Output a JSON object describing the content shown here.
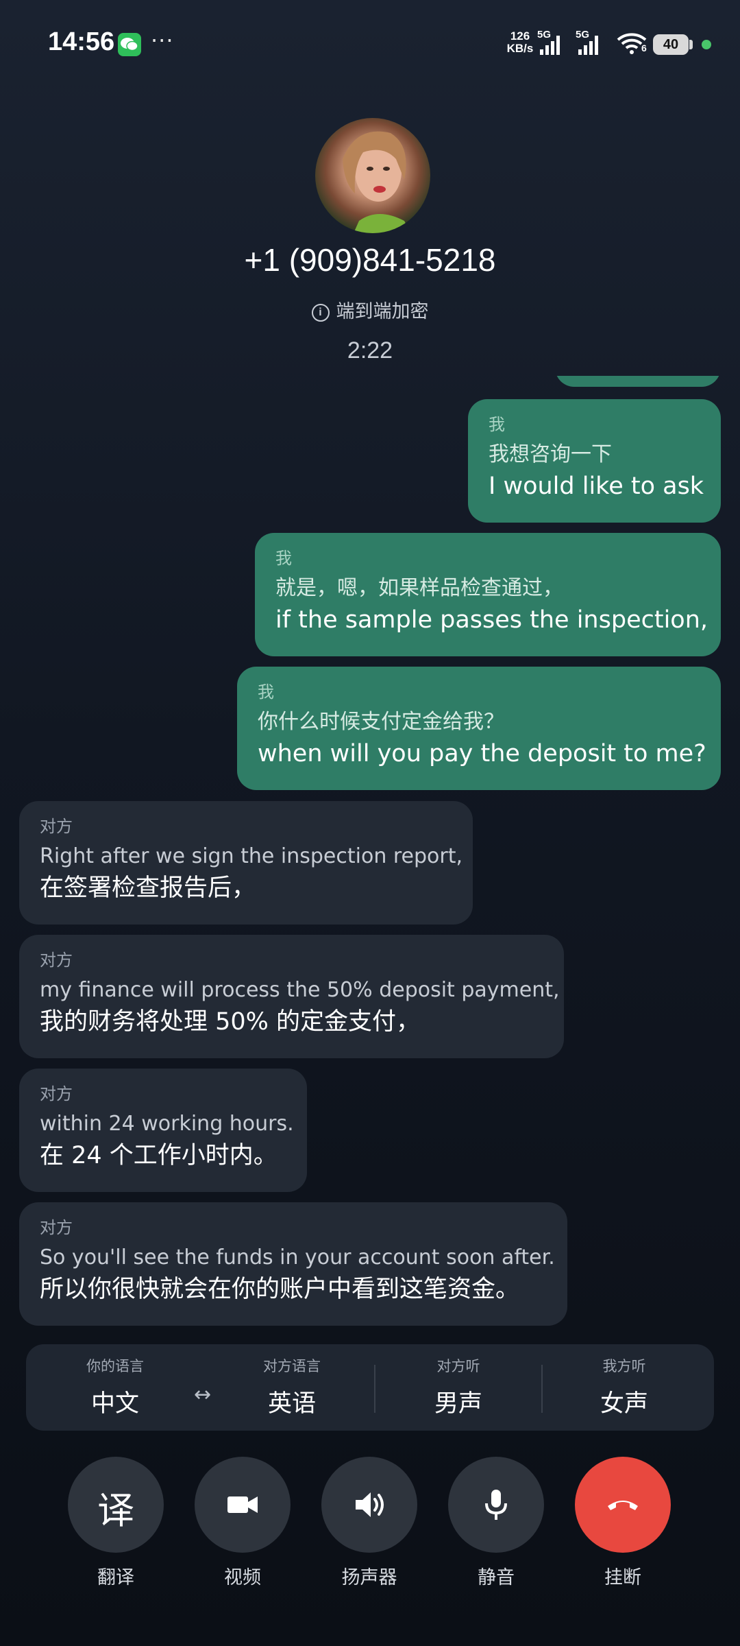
{
  "status_bar": {
    "time": "14:56",
    "more": "···",
    "net_speed_value": "126",
    "net_speed_unit": "KB/s",
    "sim1_label": "5G",
    "sim2_label": "5G",
    "wifi_label": "6",
    "battery": "40"
  },
  "call": {
    "contact_number": "+1 (909)841-5218",
    "encryption_label": "端到端加密",
    "duration": "2:22"
  },
  "transcript": [
    {
      "speaker": "我",
      "source": "我想咨询一下",
      "translation": "I would like to ask"
    },
    {
      "speaker": "我",
      "source": "就是，嗯，如果样品检查通过，",
      "translation": "if the sample passes the inspection,"
    },
    {
      "speaker": "我",
      "source": "你什么时候支付定金给我？",
      "translation": "when will you pay the deposit to me?"
    },
    {
      "speaker": "对方",
      "source": "Right after we sign the inspection report,",
      "translation": "在签署检查报告后，"
    },
    {
      "speaker": "对方",
      "source": "my finance will process the 50% deposit payment,",
      "translation": "我的财务将处理 50% 的定金支付，"
    },
    {
      "speaker": "对方",
      "source": "within 24 working hours.",
      "translation": "在 24 个工作小时内。"
    },
    {
      "speaker": "对方",
      "source": "So you'll see the funds in your account soon after.",
      "translation": "所以你很快就会在你的账户中看到这笔资金。"
    }
  ],
  "settings": {
    "my_language_label": "你的语言",
    "my_language_value": "中文",
    "swap_icon": "↔",
    "their_language_label": "对方语言",
    "their_language_value": "英语",
    "they_hear_label": "对方听",
    "they_hear_value": "男声",
    "i_hear_label": "我方听",
    "i_hear_value": "女声"
  },
  "controls": {
    "translate_glyph": "译",
    "translate_label": "翻译",
    "video_label": "视频",
    "speaker_label": "扬声器",
    "mute_label": "静音",
    "hangup_label": "挂断"
  },
  "colors": {
    "my_bubble": "#2f7d66",
    "their_bubble": "#232a35",
    "hangup": "#e8483f"
  }
}
